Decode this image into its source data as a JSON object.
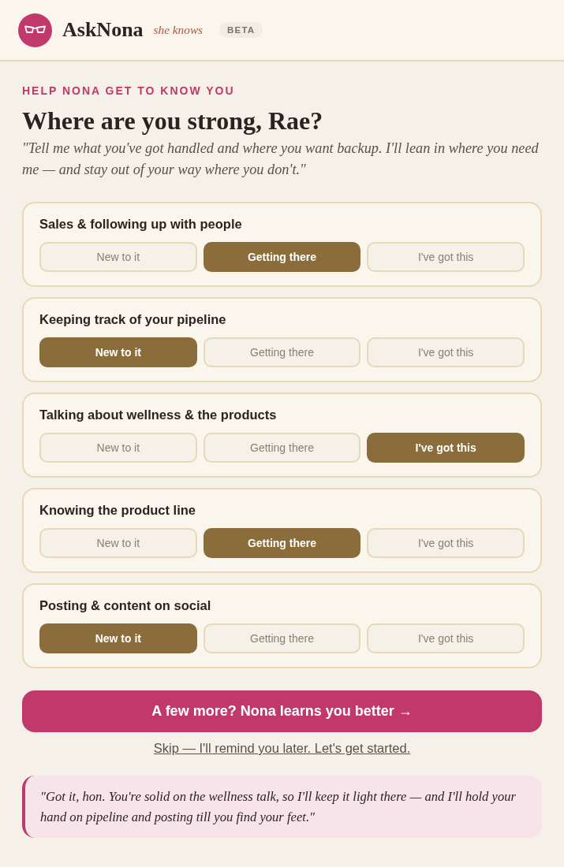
{
  "header": {
    "brand": "AskNona",
    "tagline": "she knows",
    "badge": "BETA"
  },
  "intro": {
    "eyebrow": "HELP NONA GET TO KNOW YOU",
    "title": "Where are you strong, Rae?",
    "quote": "\"Tell me what you've got handled and where you want backup. I'll lean in where you need me — and stay out of your way where you don't.\""
  },
  "skills": [
    {
      "name": "Sales & following up with people",
      "options": [
        {
          "label": "New to it",
          "selected": false
        },
        {
          "label": "Getting there",
          "selected": true
        },
        {
          "label": "I've got this",
          "selected": false
        }
      ]
    },
    {
      "name": "Keeping track of your pipeline",
      "options": [
        {
          "label": "New to it",
          "selected": true
        },
        {
          "label": "Getting there",
          "selected": false
        },
        {
          "label": "I've got this",
          "selected": false
        }
      ]
    },
    {
      "name": "Talking about wellness & the products",
      "options": [
        {
          "label": "New to it",
          "selected": false
        },
        {
          "label": "Getting there",
          "selected": false
        },
        {
          "label": "I've got this",
          "selected": true
        }
      ]
    },
    {
      "name": "Knowing the product line",
      "options": [
        {
          "label": "New to it",
          "selected": false
        },
        {
          "label": "Getting there",
          "selected": true
        },
        {
          "label": "I've got this",
          "selected": false
        }
      ]
    },
    {
      "name": "Posting & content on social",
      "options": [
        {
          "label": "New to it",
          "selected": true
        },
        {
          "label": "Getting there",
          "selected": false
        },
        {
          "label": "I've got this",
          "selected": false
        }
      ]
    }
  ],
  "primary_button": "A few more? Nona learns you better →",
  "skip_link": "Skip — I'll remind you later. Let's get started.",
  "response": "\"Got it, hon. You're solid on the wellness talk, so I'll keep it light there — and I'll hold your hand on pipeline and posting till you find your feet.\""
}
